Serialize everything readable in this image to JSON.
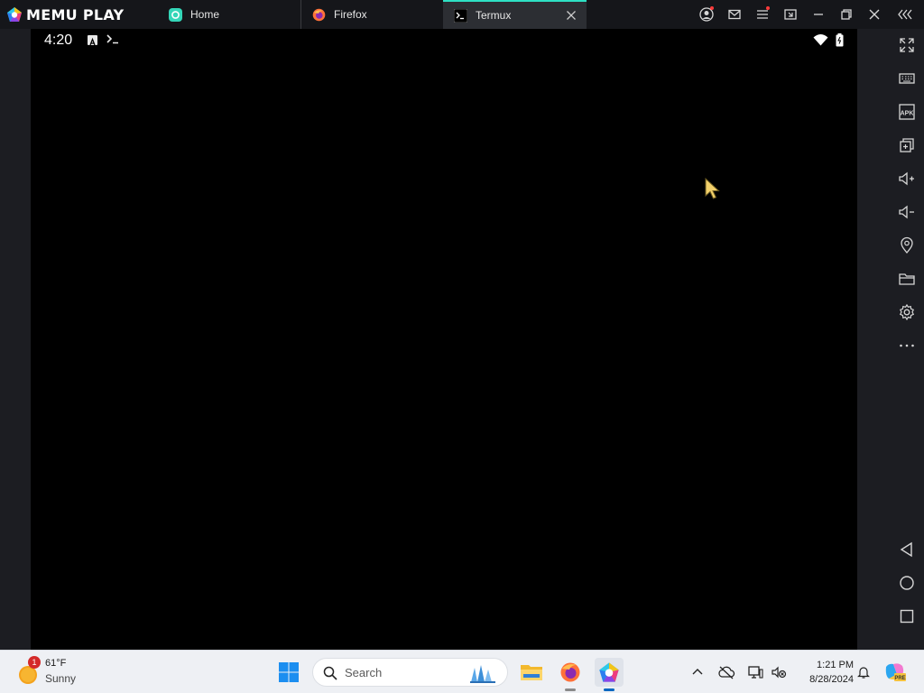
{
  "titlebar": {
    "brand": "MEMU PLAY",
    "tabs": [
      {
        "label": "Home",
        "active": false
      },
      {
        "label": "Firefox",
        "active": false
      },
      {
        "label": "Termux",
        "active": true
      }
    ]
  },
  "android": {
    "status_time": "4:20",
    "notification_icons": [
      "a-icon",
      "terminal-icon"
    ],
    "status_right_icons": [
      "wifi-icon",
      "battery-icon"
    ]
  },
  "side_toolbar": {
    "items": [
      "fullscreen-icon",
      "keyboard-icon",
      "apk-icon",
      "multi-instance-icon",
      "volume-up-icon",
      "volume-down-icon",
      "location-icon",
      "folder-icon",
      "settings-icon",
      "more-icon"
    ],
    "apk_label": "APK",
    "nav": [
      "back-icon",
      "home-icon",
      "recents-icon"
    ]
  },
  "taskbar": {
    "weather_badge": "1",
    "weather_temp": "61°F",
    "weather_desc": "Sunny",
    "search_placeholder": "Search",
    "clock_time": "1:21 PM",
    "clock_date": "8/28/2024",
    "copilot_label": "PRE"
  },
  "colors": {
    "accent_tab": "#2ee0c4",
    "android_bg": "#000000",
    "chrome_bg": "#1c1d22",
    "taskbar_bg": "#eef0f4"
  }
}
